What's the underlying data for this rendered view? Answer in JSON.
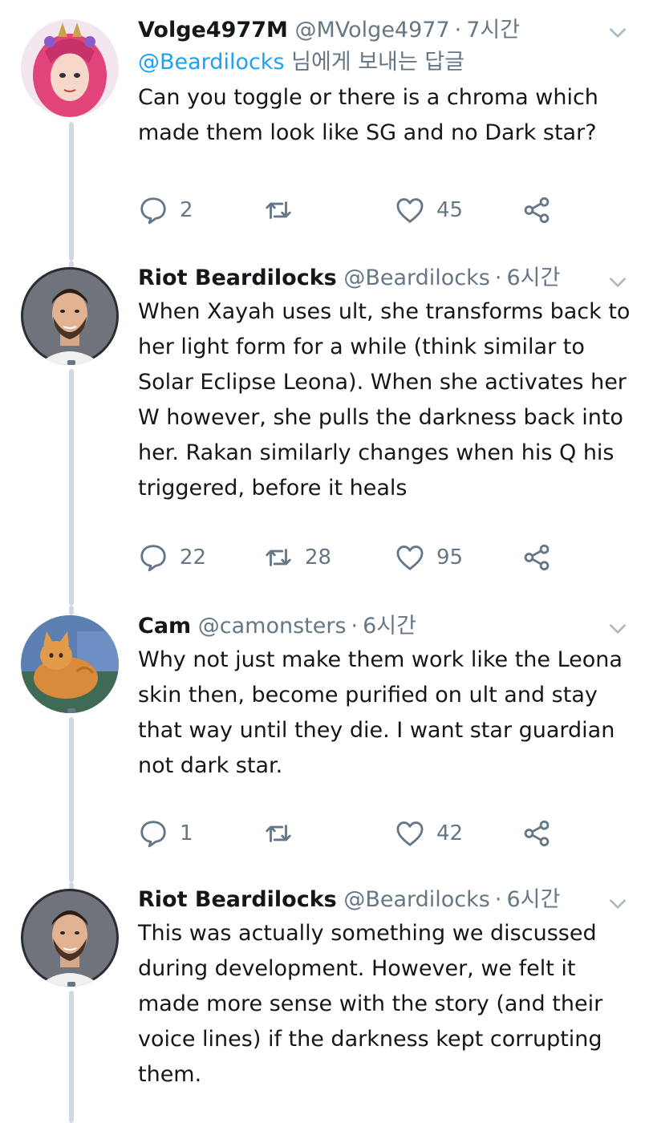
{
  "tweets": [
    {
      "name": "Volge4977M",
      "handle": "@MVolge4977",
      "time": "7시간",
      "reply_prefix": "@Beardilocks",
      "reply_suffix": " 님에게 보내는 답글",
      "text": "Can you toggle or there is a chroma which\nmade them look like SG and no Dark star?",
      "replies": "2",
      "retweets": "",
      "likes": "45",
      "avatar": "pink-hair-avatar"
    },
    {
      "name": "Riot Beardilocks",
      "handle": "@Beardilocks",
      "time": "6시간",
      "text": "When Xayah uses ult, she transforms back to\nher light form for a while (think similar to\nSolar Eclipse Leona). When she activates her\nW however, she pulls the darkness back into\nher. Rakan similarly changes when his Q his\ntriggered, before it heals",
      "replies": "22",
      "retweets": "28",
      "likes": "95",
      "avatar": "bearded-man-avatar"
    },
    {
      "name": "Cam",
      "handle": "@camonsters",
      "time": "6시간",
      "text": "Why not just make them work like the Leona\nskin then, become purified on ult and stay\nthat way until they die. I want star guardian\nnot dark star.",
      "replies": "1",
      "retweets": "",
      "likes": "42",
      "avatar": "orange-cat-avatar"
    },
    {
      "name": "Riot Beardilocks",
      "handle": "@Beardilocks",
      "time": "6시간",
      "text": "This was actually something we discussed\nduring development. However, we felt it\nmade more sense with the story (and their\nvoice lines) if the darkness kept corrupting\nthem.",
      "avatar": "bearded-man-avatar"
    }
  ],
  "separator": "·",
  "colors": {
    "accent": "#1da1f2",
    "secondary_text": "#657786",
    "thread_line": "#cfd9de"
  }
}
